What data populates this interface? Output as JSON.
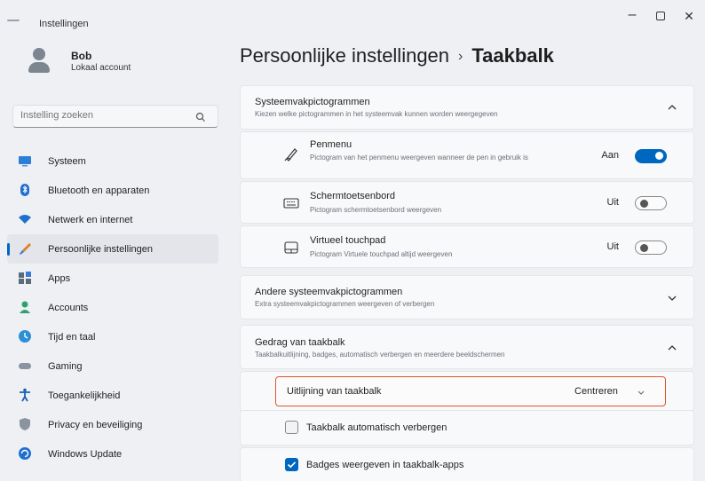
{
  "window": {
    "title": "Instellingen",
    "controls": {
      "minimize": "–",
      "close": "✕"
    }
  },
  "user": {
    "name": "Bob",
    "account_type": "Lokaal account"
  },
  "search": {
    "placeholder": "Instelling zoeken"
  },
  "sidebar": {
    "items": [
      {
        "label": "Systeem",
        "icon": "monitor-icon",
        "color": "#2b7fd9"
      },
      {
        "label": "Bluetooth en apparaten",
        "icon": "bluetooth-icon",
        "color": "#1f6fd1"
      },
      {
        "label": "Netwerk en internet",
        "icon": "wifi-icon",
        "color": "#1f6fd1"
      },
      {
        "label": "Persoonlijke instellingen",
        "icon": "brush-icon",
        "color": "#d9822b",
        "active": true
      },
      {
        "label": "Apps",
        "icon": "apps-icon",
        "color": "#5b6b7c"
      },
      {
        "label": "Accounts",
        "icon": "person-icon",
        "color": "#2ca36b"
      },
      {
        "label": "Tijd en taal",
        "icon": "globe-clock-icon",
        "color": "#2b8fd9"
      },
      {
        "label": "Gaming",
        "icon": "gamepad-icon",
        "color": "#8a94a0"
      },
      {
        "label": "Toegankelijkheid",
        "icon": "accessibility-icon",
        "color": "#1a5fb4"
      },
      {
        "label": "Privacy en beveiliging",
        "icon": "shield-icon",
        "color": "#8a94a0"
      },
      {
        "label": "Windows Update",
        "icon": "update-icon",
        "color": "#1f6fd1"
      }
    ]
  },
  "breadcrumb": {
    "parent": "Persoonlijke instellingen",
    "separator": "›",
    "current": "Taakbalk"
  },
  "tray_icons": {
    "title": "Systeemvakpictogrammen",
    "subtitle": "Kiezen welke pictogrammen in het systeemvak kunnen worden weergegeven",
    "items": [
      {
        "title": "Penmenu",
        "desc": "Pictogram van het penmenu weergeven wanneer de pen in gebruik is",
        "state_label": "Aan",
        "on": true,
        "icon": "pen-icon"
      },
      {
        "title": "Schermtoetsenbord",
        "desc": "Pictogram schermtoetsenbord weergeven",
        "state_label": "Uit",
        "on": false,
        "icon": "keyboard-icon"
      },
      {
        "title": "Virtueel touchpad",
        "desc": "Pictogram Virtuele touchpad altijd weergeven",
        "state_label": "Uit",
        "on": false,
        "icon": "touchpad-icon"
      }
    ]
  },
  "other_tray": {
    "title": "Andere systeemvakpictogrammen",
    "subtitle": "Extra systeemvakpictogrammen weergeven of verbergen"
  },
  "behavior": {
    "title": "Gedrag van taakbalk",
    "subtitle": "Taakbalkuitlijning, badges, automatisch verbergen en meerdere beeldschermen",
    "alignment_label": "Uitlijning van taakbalk",
    "alignment_value": "Centreren",
    "autohide_label": "Taakbalk automatisch verbergen",
    "autohide_checked": false,
    "badges_label": "Badges weergeven in taakbalk-apps",
    "badges_checked": true
  },
  "colors": {
    "accent": "#0067c0",
    "highlight": "#e0552e"
  }
}
